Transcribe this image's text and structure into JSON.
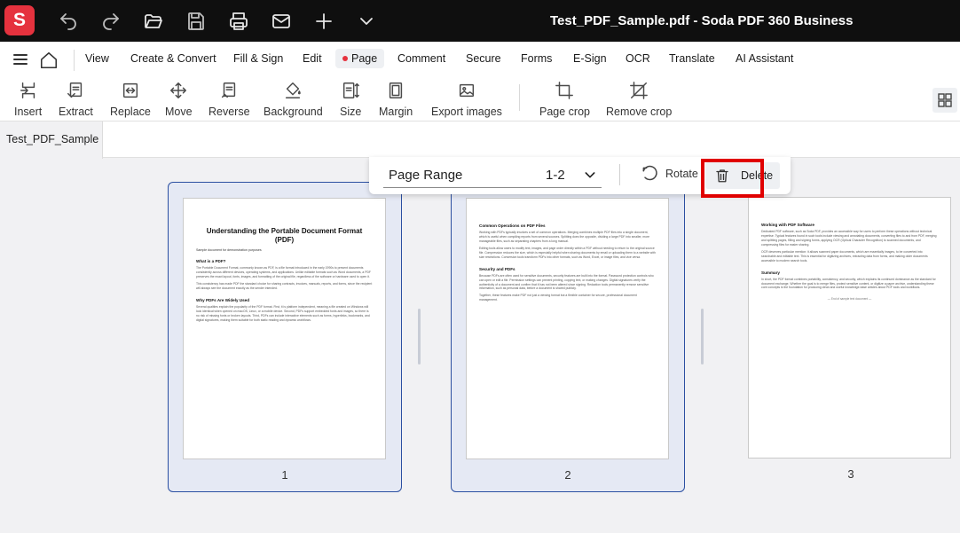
{
  "app": {
    "logo_letter": "S",
    "window_title": "Test_PDF_Sample.pdf  -  Soda PDF 360 Business"
  },
  "colors": {
    "brand": "#e5323e",
    "selection_border": "#2b4fa1",
    "highlight": "#e00000"
  },
  "titlebar": {
    "icons": [
      "undo-icon",
      "redo-icon",
      "open-folder-icon",
      "save-icon",
      "print-icon",
      "mail-icon",
      "plus-icon",
      "chevron-down-icon"
    ]
  },
  "menu": {
    "items": [
      "View",
      "Create & Convert",
      "Fill & Sign",
      "Edit",
      "Page",
      "Comment",
      "Secure",
      "Forms",
      "E-Sign",
      "OCR",
      "Translate",
      "AI Assistant"
    ],
    "active": "Page"
  },
  "toolbar": {
    "tools": [
      "Insert",
      "Extract",
      "Replace",
      "Move",
      "Reverse",
      "Background",
      "Size",
      "Margin",
      "Export images",
      "Page crop",
      "Remove crop"
    ]
  },
  "tabs": {
    "document": "Test_PDF_Sample"
  },
  "page_actions": {
    "range_label": "Page Range",
    "range_value": "1-2",
    "rotate_label": "Rotate",
    "delete_label": "Delete"
  },
  "pages": [
    {
      "number": "1",
      "selected": true,
      "title": "Understanding the Portable Document Format (PDF)",
      "subtitle": "Sample document for demonstration purposes",
      "sections": [
        {
          "heading": "What is a PDF?",
          "text": "The Portable Document Format, commonly known as PDF, is a file format introduced in the early 1990s to present documents consistently across different devices, operating systems, and applications. Unlike editable formats such as Word documents, a PDF preserves the exact layout, fonts, images, and formatting of the original file, regardless of the software or hardware used to open it."
        },
        {
          "heading": "",
          "text": "This consistency has made PDF the standard choice for sharing contracts, invoices, manuals, reports, and forms, since the recipient will always see the document exactly as the sender intended."
        },
        {
          "heading": "Why PDFs Are Widely Used",
          "text": "Several qualities explain the popularity of the PDF format. First, it is platform independent, meaning a file created on Windows will look identical when opened on macOS, Linux, or a mobile device. Second, PDFs support embedded fonts and images, so there is no risk of missing fonts or broken layouts. Third, PDFs can include interactive elements such as forms, hyperlinks, bookmarks, and digital signatures, making them suitable for both static reading and dynamic workflows."
        }
      ]
    },
    {
      "number": "2",
      "selected": true,
      "title": "",
      "subtitle": "",
      "sections": [
        {
          "heading": "Common Operations on PDF Files",
          "text": "Working with PDFs typically involves a set of common operations. Merging combines multiple PDF files into a single document, which is useful when compiling reports from several sources. Splitting does the opposite, dividing a large PDF into smaller, more manageable files, such as separating chapters from a long manual."
        },
        {
          "heading": "",
          "text": "Editing tools allow users to modify text, images, and page order directly within a PDF without needing to return to the original source file. Compression reduces the size, which is especially helpful when sharing documents by email or uploading them to a website with size restrictions. Conversion tools transform PDFs into other formats, such as Word, Excel, or image files, and vice versa."
        },
        {
          "heading": "Security and PDFs",
          "text": "Because PDFs are often used for sensitive documents, security features are built into the format. Password protection controls who can open or edit a file. Permission settings can prevent printing, copying text, or making changes. Digital signatures verify the authenticity of a document and confirm that it has not been altered since signing. Redaction tools permanently remove sensitive information, such as personal data, before a document is shared publicly."
        },
        {
          "heading": "",
          "text": "Together, these features make PDF not just a viewing format but a flexible container for secure, professional document management."
        }
      ]
    },
    {
      "number": "3",
      "selected": false,
      "title": "",
      "subtitle": "",
      "sections": [
        {
          "heading": "Working with PDF Software",
          "text": "Dedicated PDF software, such as Soda PDF, provides an accessible way for users to perform these operations without technical expertise. Typical features found in such tools include viewing and annotating documents, converting files to and from PDF, merging and splitting pages, filling and signing forms, applying OCR (Optical Character Recognition) to scanned documents, and compressing files for easier sharing."
        },
        {
          "heading": "",
          "text": "OCR deserves particular mention: it allows scanned paper documents, which are essentially images, to be converted into searchable and editable text. This is essential for digitizing archives, extracting data from forms, and making older documents accessible to modern search tools."
        },
        {
          "heading": "Summary",
          "text": "In short, the PDF format combines portability, consistency, and security, which explains its continued dominance as the standard for document exchange. Whether the goal is to merge files, protect sensitive content, or digitize a paper archive, understanding these core concepts is the foundation for producing clean and useful knowledge-base articles about PDF tools and workflows."
        }
      ],
      "end_note": "— End of sample text document —"
    }
  ]
}
